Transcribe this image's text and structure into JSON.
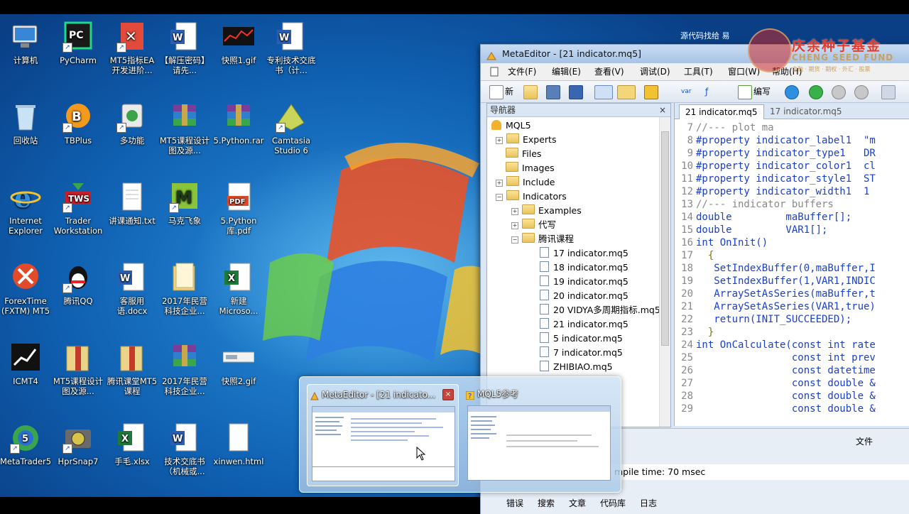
{
  "colors": {
    "desktop_bg": "#1565b8",
    "accent": "#1a3fc8",
    "logo_red": "#e63a2a"
  },
  "desktop": {
    "icons": [
      {
        "label": "计算机",
        "icon": "computer-icon"
      },
      {
        "label": "PyCharm",
        "icon": "pycharm-icon"
      },
      {
        "label": "MT5指标EA开发进阶...",
        "icon": "xmind-icon"
      },
      {
        "label": "【解压密码】请先...",
        "icon": "word-doc-icon"
      },
      {
        "label": "快照1.gif",
        "icon": "image-icon"
      },
      {
        "label": "专利技术交底书（计...",
        "icon": "word-doc-icon"
      },
      {
        "label": "回收站",
        "icon": "recycle-bin-icon"
      },
      {
        "label": "TBPlus",
        "icon": "tbplus-icon"
      },
      {
        "label": "多功能",
        "icon": "app-icon"
      },
      {
        "label": "MT5课程设计图及源...",
        "icon": "rar-icon"
      },
      {
        "label": "5.Python.rar",
        "icon": "rar-icon"
      },
      {
        "label": "Camtasia Studio 6",
        "icon": "camtasia-icon"
      },
      {
        "label": "Internet Explorer",
        "icon": "ie-icon"
      },
      {
        "label": "Trader Workstation",
        "icon": "tws-icon"
      },
      {
        "label": "讲课通知.txt",
        "icon": "text-file-icon"
      },
      {
        "label": "马克飞象",
        "icon": "markdown-icon"
      },
      {
        "label": "5.Python库.pdf",
        "icon": "pdf-icon"
      },
      {
        "label": "ForexTime (FXTM) MT5",
        "icon": "fxtm-icon"
      },
      {
        "label": "腾讯QQ",
        "icon": "qq-icon"
      },
      {
        "label": "客服用语.docx",
        "icon": "word-doc-icon"
      },
      {
        "label": "2017年民营科技企业...",
        "icon": "folder-icon"
      },
      {
        "label": "新建 Microso...",
        "icon": "excel-icon"
      },
      {
        "label": "ICMT4",
        "icon": "icmt4-icon"
      },
      {
        "label": "MT5课程设计图及源...",
        "icon": "folder-zip-icon"
      },
      {
        "label": "腾讯课堂MT5课程",
        "icon": "folder-zip-icon"
      },
      {
        "label": "2017年民营科技企业...",
        "icon": "rar-icon"
      },
      {
        "label": "快照2.gif",
        "icon": "image-icon"
      },
      {
        "label": "MetaTrader5",
        "icon": "metatrader-icon"
      },
      {
        "label": "HprSnap7",
        "icon": "camera-icon"
      },
      {
        "label": "手毛.xlsx",
        "icon": "excel-icon"
      },
      {
        "label": "技术交底书（机械或...",
        "icon": "word-doc-icon"
      },
      {
        "label": "xinwen.html",
        "icon": "html-file-icon"
      }
    ]
  },
  "watermark": {
    "name": "庆余种子基金",
    "sub": "CHENG SEED FUND",
    "tag": "金融 · 期货 · 期权 · 外汇 · 股票",
    "source_note": "源代码找给  易"
  },
  "metaeditor": {
    "title": "MetaEditor - [21 indicator.mq5]",
    "menu": [
      "文件(F)",
      "编辑(E)",
      "查看(V)",
      "调试(D)",
      "工具(T)",
      "窗口(W)",
      "帮助(H)"
    ],
    "toolbar": {
      "new_label": "新",
      "compile_label": "编写",
      "var_label": "var"
    },
    "navigator": {
      "title": "导航器",
      "close": "×",
      "items": [
        {
          "label": "MQL5",
          "type": "root",
          "depth": 0
        },
        {
          "label": "Experts",
          "type": "folder",
          "depth": 1
        },
        {
          "label": "Files",
          "type": "folder",
          "depth": 1
        },
        {
          "label": "Images",
          "type": "folder",
          "depth": 1
        },
        {
          "label": "Include",
          "type": "folder",
          "depth": 1
        },
        {
          "label": "Indicators",
          "type": "folder",
          "depth": 1
        },
        {
          "label": "Examples",
          "type": "folder",
          "depth": 2
        },
        {
          "label": "代写",
          "type": "folder",
          "depth": 2
        },
        {
          "label": "腾讯课程",
          "type": "folder",
          "depth": 2
        },
        {
          "label": "17 indicator.mq5",
          "type": "file",
          "depth": 3
        },
        {
          "label": "18 indicator.mq5",
          "type": "file",
          "depth": 3
        },
        {
          "label": "19 indicator.mq5",
          "type": "file",
          "depth": 3
        },
        {
          "label": "20 indicator.mq5",
          "type": "file",
          "depth": 3
        },
        {
          "label": "20 VIDYA多周期指标.mq5",
          "type": "file",
          "depth": 3
        },
        {
          "label": "21 indicator.mq5",
          "type": "file",
          "depth": 3
        },
        {
          "label": "5 indicator.mq5",
          "type": "file",
          "depth": 3
        },
        {
          "label": "7 indicator.mq5",
          "type": "file",
          "depth": 3
        },
        {
          "label": "ZHIBIAO.mq5",
          "type": "file",
          "depth": 3
        }
      ]
    },
    "tabs": [
      "21 indicator.mq5",
      "17 indicator.mq5"
    ],
    "code_lines": [
      {
        "n": "7",
        "text": "//--- plot ma",
        "kind": "comment"
      },
      {
        "n": "8",
        "text": "#property indicator_label1  \"m",
        "kind": "prop"
      },
      {
        "n": "9",
        "text": "#property indicator_type1   DR",
        "kind": "prop"
      },
      {
        "n": "10",
        "text": "#property indicator_color1  cl",
        "kind": "prop"
      },
      {
        "n": "11",
        "text": "#property indicator_style1  ST",
        "kind": "prop"
      },
      {
        "n": "12",
        "text": "#property indicator_width1  1",
        "kind": "prop"
      },
      {
        "n": "13",
        "text": "//--- indicator buffers",
        "kind": "comment"
      },
      {
        "n": "14",
        "text": "double         maBuffer[];",
        "kind": "decl"
      },
      {
        "n": "15",
        "text": "double         VAR1[];",
        "kind": "decl"
      },
      {
        "n": "16",
        "text": "int OnInit()",
        "kind": "decl"
      },
      {
        "n": "17",
        "text": "  {",
        "kind": "plain"
      },
      {
        "n": "18",
        "text": "   SetIndexBuffer(0,maBuffer,I",
        "kind": "call"
      },
      {
        "n": "19",
        "text": "   SetIndexBuffer(1,VAR1,INDIC",
        "kind": "call"
      },
      {
        "n": "20",
        "text": "   ArraySetAsSeries(maBuffer,t",
        "kind": "call"
      },
      {
        "n": "21",
        "text": "   ArraySetAsSeries(VAR1,true)",
        "kind": "call"
      },
      {
        "n": "22",
        "text": "   return(INIT_SUCCEEDED);",
        "kind": "call"
      },
      {
        "n": "23",
        "text": "  }",
        "kind": "plain"
      },
      {
        "n": "24",
        "text": "int OnCalculate(const int rate",
        "kind": "decl"
      },
      {
        "n": "25",
        "text": "                const int prev",
        "kind": "decl"
      },
      {
        "n": "26",
        "text": "                const datetime",
        "kind": "decl"
      },
      {
        "n": "27",
        "text": "                const double &",
        "kind": "decl"
      },
      {
        "n": "28",
        "text": "                const double &",
        "kind": "decl"
      },
      {
        "n": "29",
        "text": "                const double &",
        "kind": "decl"
      }
    ],
    "lower": {
      "col_header": "文件",
      "status": "mpile time: 70 msec",
      "bottom_tabs": [
        "错误",
        "搜索",
        "文章",
        "代码库",
        "日志"
      ]
    }
  },
  "taskbar_preview": {
    "items": [
      {
        "title": "MetaEditor - [21 indicato...",
        "close": "×"
      },
      {
        "title": "MQL5参考",
        "close": ""
      }
    ]
  }
}
